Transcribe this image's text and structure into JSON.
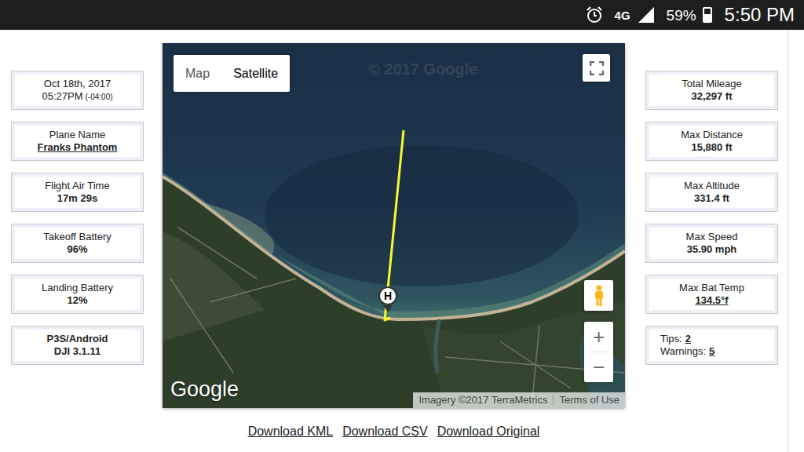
{
  "status_bar": {
    "network": "4G",
    "battery": "59%",
    "battery_level": 0.59,
    "time": "5:50 PM"
  },
  "left_cards": [
    {
      "kind": "date",
      "label": "Oct 18th, 2017",
      "value": "05:27PM",
      "note": "(-04:00)"
    },
    {
      "kind": "link",
      "label": "Plane Name",
      "value": "Franks Phantom"
    },
    {
      "kind": "stat",
      "label": "Flight Air Time",
      "value": "17m 29s"
    },
    {
      "kind": "stat",
      "label": "Takeoff Battery",
      "value": "96%"
    },
    {
      "kind": "stat",
      "label": "Landing Battery",
      "value": "12%"
    },
    {
      "kind": "app",
      "label": "P3S/Android",
      "value": "DJI 3.1.11"
    }
  ],
  "right_cards": [
    {
      "kind": "stat",
      "label": "Total Mileage",
      "value": "32,297 ft"
    },
    {
      "kind": "stat",
      "label": "Max Distance",
      "value": "15,880 ft"
    },
    {
      "kind": "stat",
      "label": "Max Altitude",
      "value": "331.4 ft"
    },
    {
      "kind": "stat",
      "label": "Max Speed",
      "value": "35.90 mph"
    },
    {
      "kind": "link",
      "label": "Max Bat Temp",
      "value": "134.5°f"
    },
    {
      "kind": "counts",
      "items": [
        {
          "label": "Tips:",
          "value": "2"
        },
        {
          "label": "Warnings:",
          "value": "5"
        }
      ]
    }
  ],
  "map": {
    "tabs": [
      {
        "label": "Map",
        "selected": false
      },
      {
        "label": "Satellite",
        "selected": true
      }
    ],
    "watermark": "© 2017 Google",
    "home_marker": "H",
    "zoom_in": "+",
    "zoom_out": "−",
    "logo": "Google",
    "imagery": "Imagery ©2017 TerraMetrics",
    "terms": "Terms of Use"
  },
  "links": [
    "Download KML",
    "Download CSV",
    "Download Original"
  ]
}
